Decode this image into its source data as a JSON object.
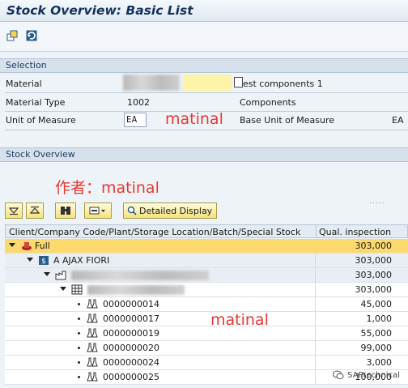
{
  "window": {
    "title": "Stock Overview: Basic List"
  },
  "toolbar": {
    "icons": [
      "new-selection-icon",
      "refresh-icon"
    ]
  },
  "selection": {
    "header": "Selection",
    "material_label": "Material",
    "material_desc": "est components 1",
    "material_type_label": "Material Type",
    "material_type_value": "1002",
    "material_type_desc": "Components",
    "uom_label": "Unit of Measure",
    "uom_value": "EA",
    "base_uom_label": "Base Unit of Measure",
    "base_uom_value": "EA"
  },
  "stock_overview": {
    "header": "Stock Overview",
    "buttons": {
      "detailed_display": "Detailed Display"
    },
    "columns": [
      "Client/Company Code/Plant/Storage Location/Batch/Special Stock",
      "Qual. inspection"
    ],
    "rows": [
      {
        "name": "Full",
        "qty": "303,000",
        "level": 0
      },
      {
        "name": "A AJAX FIORI",
        "qty": "303,000",
        "level": 1
      },
      {
        "name": "",
        "qty": "303,000",
        "level": 2
      },
      {
        "name": "",
        "qty": "303,000",
        "level": 3
      },
      {
        "name": "0000000014",
        "qty": "45,000",
        "level": 4
      },
      {
        "name": "0000000017",
        "qty": "1,000",
        "level": 4
      },
      {
        "name": "0000000019",
        "qty": "55,000",
        "level": 4
      },
      {
        "name": "0000000020",
        "qty": "99,000",
        "level": 4
      },
      {
        "name": "0000000024",
        "qty": "3,000",
        "level": 4
      },
      {
        "name": "0000000025",
        "qty": "100,000",
        "level": 4
      }
    ]
  },
  "watermarks": {
    "author": "作者：matinal",
    "mark1": "matinal",
    "mark2": "matinal",
    "wechat": "SAPtechnical"
  },
  "colors": {
    "highlight": "#fbd96d",
    "accent_red": "#e53935",
    "title": "#14325a"
  }
}
